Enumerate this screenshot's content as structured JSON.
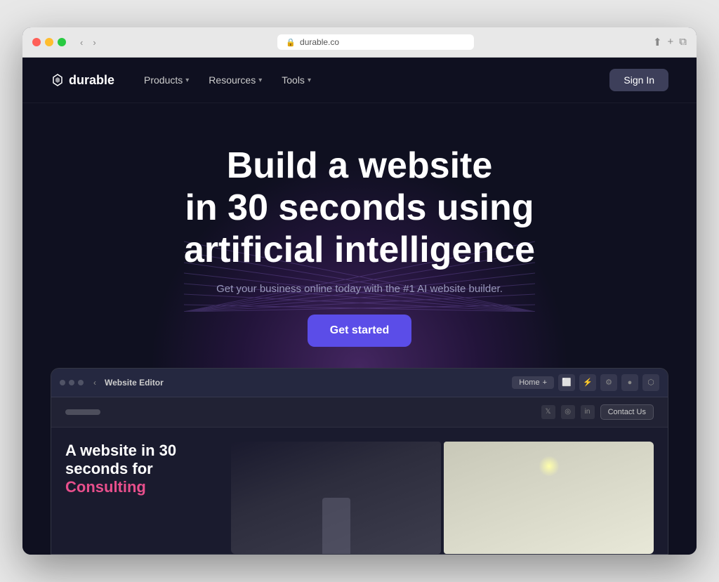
{
  "browser": {
    "url": "durable.co",
    "lock_symbol": "🔒",
    "back_label": "‹",
    "forward_label": "›"
  },
  "nav": {
    "logo_text": "durable",
    "items": [
      {
        "label": "Products",
        "has_dropdown": true
      },
      {
        "label": "Resources",
        "has_dropdown": true
      },
      {
        "label": "Tools",
        "has_dropdown": true
      }
    ],
    "sign_in_label": "Sign In"
  },
  "hero": {
    "title_line1": "Build a website",
    "title_line2": "in 30 seconds using",
    "title_line3": "artificial intelligence",
    "subtitle": "Get your business online today with the #1 AI website builder.",
    "cta_label": "Get started"
  },
  "preview": {
    "editor_label": "Website Editor",
    "back_symbol": "‹",
    "home_tab_label": "Home",
    "plus_symbol": "+",
    "contact_us_label": "Contact Us",
    "inner_title_line1": "A website in 30",
    "inner_title_line2": "seconds for",
    "inner_title_accent": "Consulting",
    "social_icons": [
      "𝕏",
      "◎",
      "in"
    ]
  },
  "colors": {
    "bg_dark": "#0f1020",
    "nav_bg": "#0f1020",
    "cta_bg": "#5b4de8",
    "accent_pink": "#e84f8c",
    "sign_in_bg": "#3d3f5a"
  }
}
